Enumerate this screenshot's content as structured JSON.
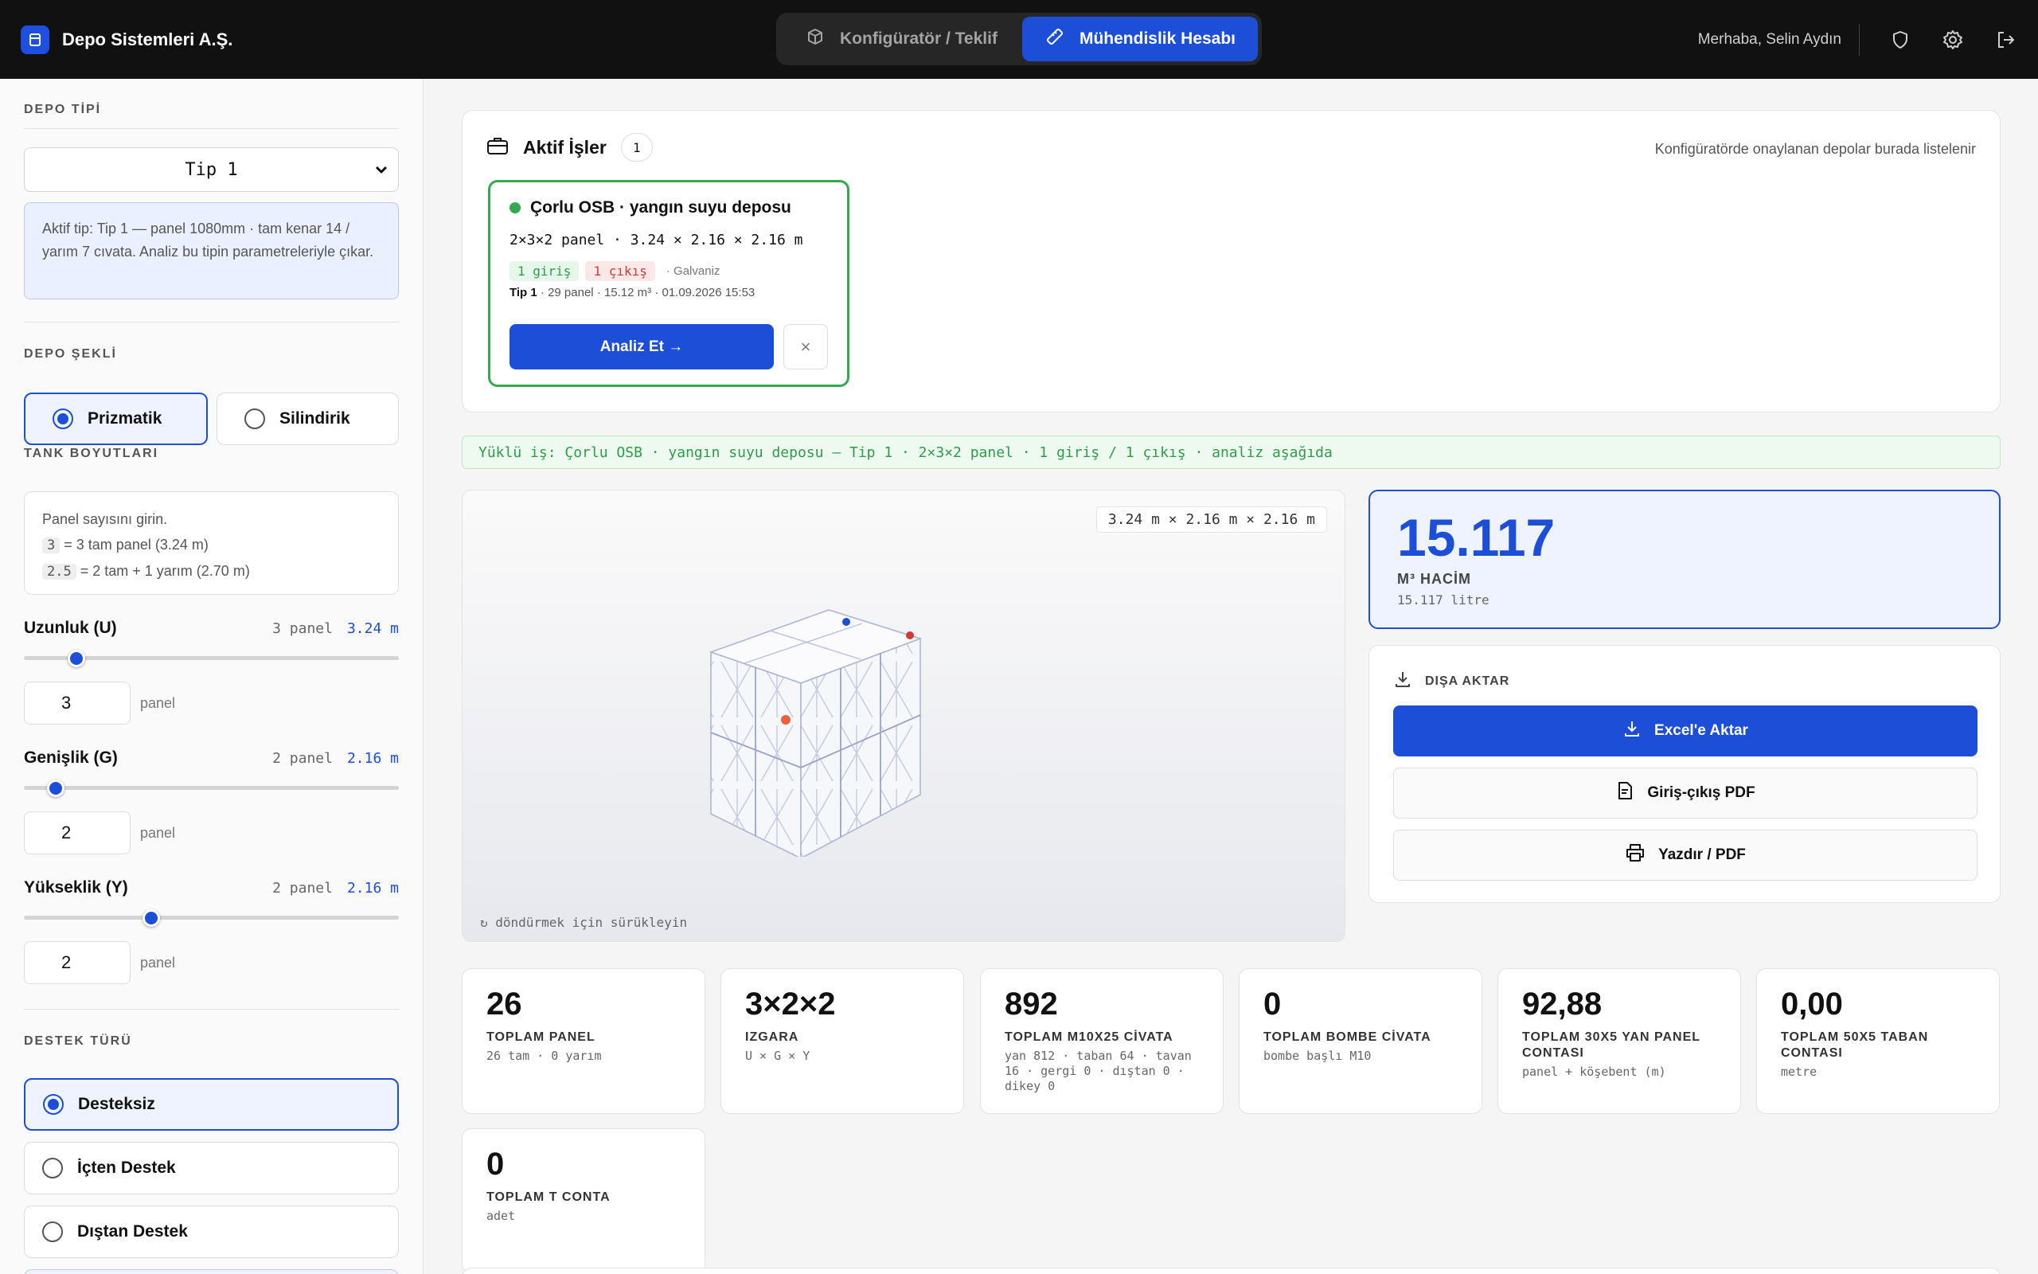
{
  "header": {
    "brand": "Depo Sistemleri A.Ş.",
    "modes": [
      {
        "label": "Konfigüratör / Teklif",
        "active": false
      },
      {
        "label": "Mühendislik Hesabı",
        "active": true
      }
    ],
    "greeting": "Merhaba, Selin Aydın",
    "icons": [
      "shield-icon",
      "gear-icon",
      "logout-icon"
    ]
  },
  "sidebar": {
    "tank_type": {
      "label": "DEPO TİPİ",
      "selected": "Tip 1",
      "info": "Aktif tip: Tip 1 — panel 1080mm · tam kenar 14 / yarım 7 cıvata. Analiz bu tipin parametreleriyle çıkar."
    },
    "shape": {
      "label": "DEPO ŞEKLİ",
      "options": [
        {
          "label": "Prizmatik",
          "selected": true
        },
        {
          "label": "Silindirik",
          "selected": false
        }
      ]
    },
    "dimensions": {
      "label": "TANK BOYUTLARI",
      "help_title": "Panel sayısını girin.",
      "help_1_key": "3",
      "help_1_text": "= 3 tam panel (3.24 m)",
      "help_2_key": "2.5",
      "help_2_text": "= 2 tam + 1 yarım (2.70 m)",
      "items": [
        {
          "name": "Uzunluk (U)",
          "panels_text": "3 panel",
          "meters": "3.24 m",
          "input": "3",
          "unit": "panel",
          "slider": 0.14
        },
        {
          "name": "Genişlik (G)",
          "panels_text": "2 panel",
          "meters": "2.16 m",
          "input": "2",
          "unit": "panel",
          "slider": 0.085
        },
        {
          "name": "Yükseklik (Y)",
          "panels_text": "2 panel",
          "meters": "2.16 m",
          "input": "2",
          "unit": "panel",
          "slider": 0.34
        }
      ]
    },
    "support": {
      "label": "DESTEK TÜRÜ",
      "options": [
        {
          "label": "Desteksiz",
          "selected": true
        },
        {
          "label": "İçten Destek",
          "selected": false
        },
        {
          "label": "Dıştan Destek",
          "selected": false
        }
      ]
    }
  },
  "jobs": {
    "title": "Aktif İşler",
    "count": "1",
    "hint": "Konfigüratörde onaylanan depolar burada listelenir",
    "items": [
      {
        "title": "Çorlu OSB · yangın suyu deposu",
        "dims": "2×3×2 panel · 3.24 × 2.16 × 2.16 m",
        "inlet": "1 giriş",
        "outlet": "1 çıkış",
        "material": "· Galvaniz",
        "type": "Tip 1",
        "meta": "· 29 panel · 15.12 m³ · 01.09.2026 15:53",
        "analyze_label": "Analiz Et →",
        "close_label": "×"
      }
    ]
  },
  "loaded_job": "Yüklü iş: Çorlu OSB · yangın suyu deposu — Tip 1 · 2×3×2 panel · 1 giriş / 1 çıkış · analiz aşağıda",
  "viewer": {
    "dims": "3.24 m × 2.16 m × 2.16 m",
    "hint": "↻ döndürmek için sürükleyin"
  },
  "volume": {
    "value": "15.117",
    "label": "M³ HACİM",
    "sub": "15.117 litre"
  },
  "export": {
    "title": "DIŞA AKTAR",
    "excel": "Excel'e Aktar",
    "pdf": "Giriş-çıkış PDF",
    "print": "Yazdır / PDF"
  },
  "stats": [
    {
      "value": "26",
      "label": "TOPLAM PANEL",
      "sub": "26 tam · 0 yarım"
    },
    {
      "value": "3×2×2",
      "label": "IZGARA",
      "sub": "U × G × Y"
    },
    {
      "value": "892",
      "label": "TOPLAM M10X25 CİVATA",
      "sub": "yan 812 · taban 64 · tavan 16 · gergi 0 · dıştan 0 · dikey 0"
    },
    {
      "value": "0",
      "label": "TOPLAM BOMBE CİVATA",
      "sub": "bombe başlı M10"
    },
    {
      "value": "92,88",
      "label": "TOPLAM 30X5 YAN PANEL CONTASI",
      "sub": "panel + köşebent (m)"
    },
    {
      "value": "0,00",
      "label": "TOPLAM 50X5 TABAN CONTASI",
      "sub": "metre"
    },
    {
      "value": "0",
      "label": "TOPLAM T CONTA",
      "sub": "adet"
    }
  ],
  "colors": {
    "accent": "#1d4ed8",
    "success": "#34a853",
    "danger": "#d23a3a",
    "topbar": "#111111"
  }
}
